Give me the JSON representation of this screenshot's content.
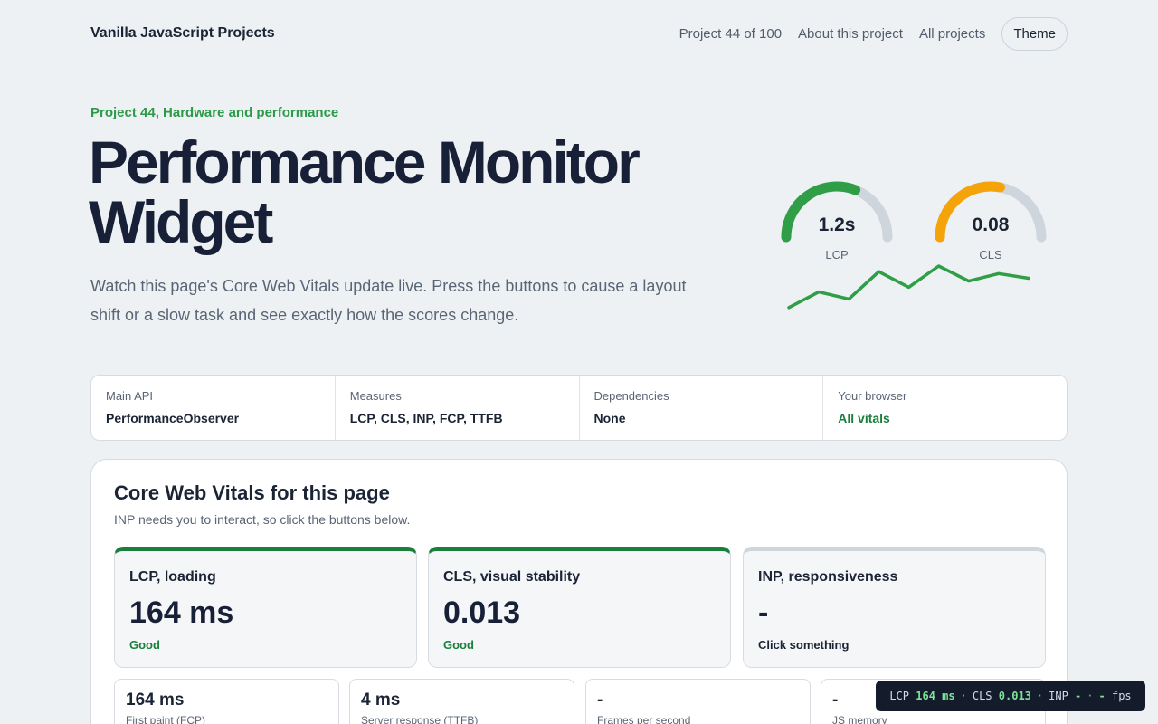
{
  "header": {
    "brand": "Vanilla JavaScript Projects",
    "project_counter": "Project 44 of 100",
    "about_link": "About this project",
    "all_link": "All projects",
    "theme_button": "Theme"
  },
  "hero": {
    "eyebrow": "Project 44, Hardware and performance",
    "title": "Performance Monitor Widget",
    "description": "Watch this page's Core Web Vitals update live. Press the buttons to cause a layout shift or a slow task and see exactly how the scores change.",
    "gauges": [
      {
        "value": "1.2s",
        "label": "LCP",
        "fill": 0.62,
        "color": "#2f9e47"
      },
      {
        "value": "0.08",
        "label": "CLS",
        "fill": 0.56,
        "color": "#f5a30a"
      }
    ],
    "trend": {
      "values": [
        0.12,
        0.45,
        0.3,
        0.88,
        0.55,
        1.0,
        0.68,
        0.84,
        0.74
      ],
      "color": "#2f9e47"
    }
  },
  "facts": [
    {
      "label": "Main API",
      "value": "PerformanceObserver"
    },
    {
      "label": "Measures",
      "value": "LCP, CLS, INP, FCP, TTFB"
    },
    {
      "label": "Dependencies",
      "value": "None"
    },
    {
      "label": "Your browser",
      "value": "All vitals"
    }
  ],
  "panel": {
    "title": "Core Web Vitals for this page",
    "subtitle": "INP needs you to interact, so click the buttons below.",
    "vitals": [
      {
        "name": "LCP, loading",
        "value": "164 ms",
        "rating": "Good"
      },
      {
        "name": "CLS, visual stability",
        "value": "0.013",
        "rating": "Good"
      },
      {
        "name": "INP, responsiveness",
        "value": "-",
        "rating": "Click something"
      }
    ],
    "metrics": [
      {
        "value": "164 ms",
        "label": "First paint (FCP)"
      },
      {
        "value": "4 ms",
        "label": "Server response (TTFB)"
      },
      {
        "value": "-",
        "label": "Frames per second"
      },
      {
        "value": "-",
        "label": "JS memory"
      }
    ]
  },
  "hud": {
    "lcp_label": "LCP",
    "lcp_value": "164 ms",
    "cls_label": "CLS",
    "cls_value": "0.013",
    "inp_label": "INP",
    "inp_value": "-",
    "fps_value": "-",
    "fps_label": "fps",
    "separator": "·"
  },
  "colors": {
    "accent_green": "#2c9a48",
    "good_green": "#1a7f3c",
    "warning_orange": "#f5a30a",
    "hud_bg": "#141c2b"
  }
}
